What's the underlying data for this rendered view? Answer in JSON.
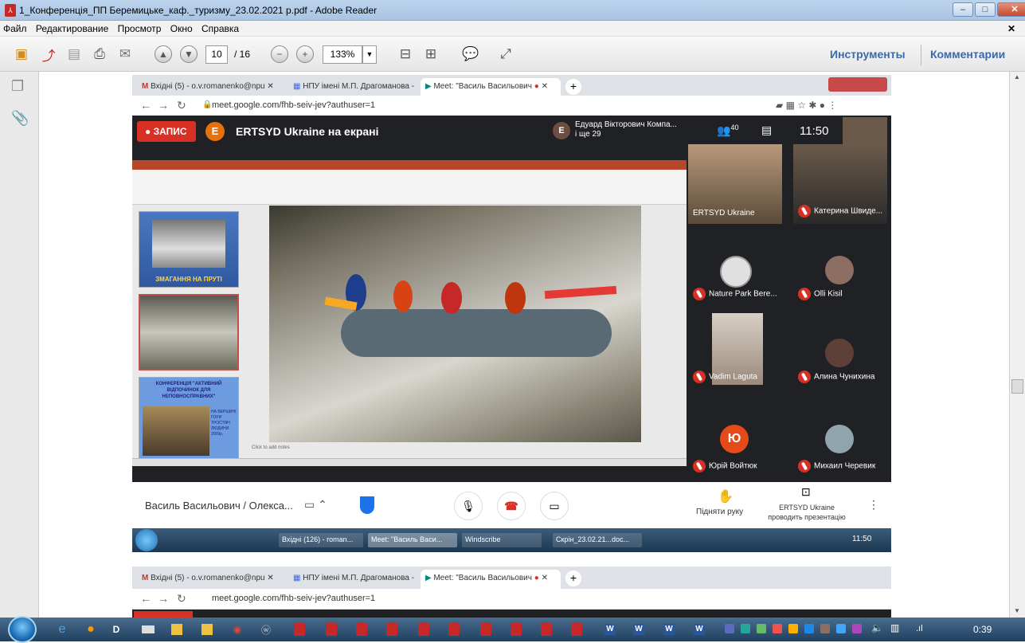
{
  "window": {
    "title": "1_Конференція_ПП Беремицьке_каф._туризму_23.02.2021 р.pdf - Adobe Reader",
    "min": "–",
    "max": "□",
    "close": "✕"
  },
  "menu": [
    "Файл",
    "Редактирование",
    "Просмотр",
    "Окно",
    "Справка"
  ],
  "toolbar": {
    "page_current": "10",
    "page_total": "/ 16",
    "zoom": "133%",
    "tools_label": "Инструменты",
    "comments_label": "Комментарии"
  },
  "browser": {
    "tabs": [
      "Вхідні (5) - o.v.romanenko@npu",
      "НПУ імені М.П. Драгоманова -",
      "Meet: \"Василь Васильович"
    ],
    "url": "meet.google.com/fhb-seiv-jev?authuser=1"
  },
  "meet": {
    "record_label": "ЗАПИС",
    "presenter_initial": "E",
    "presenter_screen": "ERTSYD Ukraine на екрані",
    "others_initial": "E",
    "others_line1": "Едуард Вікторович Компа...",
    "others_line2": "і ще 29",
    "participants_count": "40",
    "time": "11:50",
    "tiles": [
      {
        "name": "ERTSYD Ukraine"
      },
      {
        "name": "Катерина Швиде..."
      },
      {
        "name": "Nature Park Bere..."
      },
      {
        "name": "Olli Kisil"
      },
      {
        "name": "Vadim Laguta"
      },
      {
        "name": "Алина Чунихина"
      },
      {
        "name": "Юрій Войтюк",
        "initial": "Ю"
      },
      {
        "name": "Михаил Черевик"
      }
    ],
    "meeting_title": "Василь Васильович / Олекса...",
    "raise_hand": "Підняти руку",
    "presenting_line1": "ERTSYD Ukraine",
    "presenting_line2": "проводить презентацію"
  },
  "slide": {
    "thumb1_caption": "ЗМАГАННЯ НА ПРУТІ",
    "thumb3_title": "КОНФЕРЕНЦІЯ \"АКТИВНИЙ ВІДПОЧИНОК ДЛЯ НЕПОВНОСПРАВНИХ\"",
    "thumb3_side": "НА ВЕРШИНІ ГОРИ ТРОСТЯН ЛЮДИНИ 2009р.",
    "notes": "Click to add notes"
  },
  "inner_taskbar": {
    "items": [
      "Вхідні (126) - roman...",
      "Meet: \"Василь Васи...",
      "Windscribe",
      "Скрін_23.02.21...doc..."
    ],
    "time": "11:50"
  },
  "browser2": {
    "tabs": [
      "Вхідні (5) - o.v.romanenko@npu",
      "НПУ імені М.П. Драгоманова -",
      "Meet: \"Василь Васильович"
    ],
    "url": "meet.google.com/fhb-seiv-jev?authuser=1"
  },
  "taskbar": {
    "time": "0:39"
  }
}
